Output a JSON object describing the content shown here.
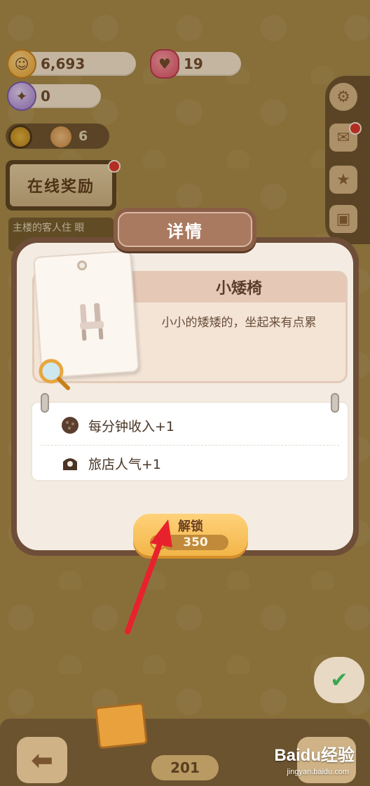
{
  "hud": {
    "coins": "6,693",
    "hearts": "19",
    "gems": "0",
    "staff_count": "6",
    "online_reward_label": "在线奖励",
    "hint_text": "主楼的客人住 眼"
  },
  "modal": {
    "title": "详情",
    "item_name": "小矮椅",
    "item_desc": "小小的矮矮的，坐起来有点累",
    "bonuses": [
      {
        "icon": "cookie-icon",
        "label": "每分钟收入+1"
      },
      {
        "icon": "popularity-icon",
        "label": "旅店人气+1"
      }
    ],
    "unlock_label": "解锁",
    "unlock_cost": "350"
  },
  "bottom": {
    "page_number": "201",
    "watermark": "Baidu经验",
    "watermark_sub": "jingyan.baidu.com"
  },
  "colors": {
    "modal_border": "#6e4e38",
    "modal_bg": "#f4ece2",
    "unlock_button": "#f2b548",
    "arrow": "#e8222c"
  }
}
